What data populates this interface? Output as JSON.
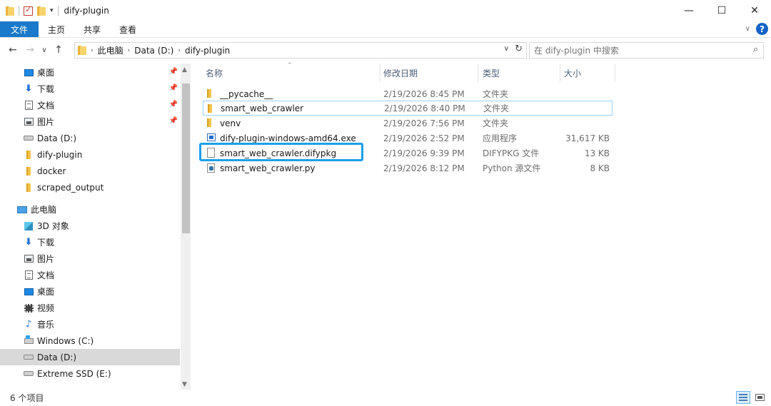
{
  "window": {
    "title": "dify-plugin",
    "minimize": "—",
    "maximize": "☐",
    "close": "✕"
  },
  "ribbon": {
    "tabs": [
      "文件",
      "主页",
      "共享",
      "查看"
    ],
    "help": "?"
  },
  "address": {
    "crumbs": [
      "此电脑",
      "Data (D:)",
      "dify-plugin"
    ]
  },
  "search": {
    "placeholder": "在 dify-plugin 中搜索"
  },
  "nav_pane": {
    "quick_access": [
      {
        "label": "桌面",
        "icon": "desktop-icon",
        "pinned": true
      },
      {
        "label": "下载",
        "icon": "download-icon",
        "pinned": true
      },
      {
        "label": "文档",
        "icon": "document-icon",
        "pinned": true
      },
      {
        "label": "图片",
        "icon": "picture-icon",
        "pinned": true
      },
      {
        "label": "Data (D:)",
        "icon": "drive-icon",
        "pinned": false
      },
      {
        "label": "dify-plugin",
        "icon": "folder-icon",
        "pinned": false
      },
      {
        "label": "docker",
        "icon": "folder-icon",
        "pinned": false
      },
      {
        "label": "scraped_output",
        "icon": "folder-icon",
        "pinned": false
      }
    ],
    "this_pc": {
      "label": "此电脑",
      "items": [
        {
          "label": "3D 对象",
          "icon": "3d-objects-icon"
        },
        {
          "label": "下载",
          "icon": "download-icon"
        },
        {
          "label": "图片",
          "icon": "picture-icon"
        },
        {
          "label": "文档",
          "icon": "document-icon"
        },
        {
          "label": "桌面",
          "icon": "desktop-icon"
        },
        {
          "label": "视频",
          "icon": "video-icon"
        },
        {
          "label": "音乐",
          "icon": "music-icon"
        },
        {
          "label": "Windows (C:)",
          "icon": "windows-drive-icon"
        },
        {
          "label": "Data (D:)",
          "icon": "drive-icon",
          "selected": true
        },
        {
          "label": "Extreme SSD (E:)",
          "icon": "drive-icon"
        }
      ]
    }
  },
  "columns": {
    "name": "名称",
    "date": "修改日期",
    "type": "类型",
    "size": "大小"
  },
  "files": [
    {
      "name": "__pycache__",
      "date": "2/19/2026 8:45 PM",
      "type": "文件夹",
      "size": "",
      "icon": "folder-icon"
    },
    {
      "name": "smart_web_crawler",
      "date": "2/19/2026 8:40 PM",
      "type": "文件夹",
      "size": "",
      "icon": "folder-icon"
    },
    {
      "name": "venv",
      "date": "2/19/2026 7:56 PM",
      "type": "文件夹",
      "size": "",
      "icon": "folder-icon"
    },
    {
      "name": "dify-plugin-windows-amd64.exe",
      "date": "2/19/2026 2:52 PM",
      "type": "应用程序",
      "size": "31,617 KB",
      "icon": "exe-icon"
    },
    {
      "name": "smart_web_crawler.difypkg",
      "date": "2/19/2026 9:39 PM",
      "type": "DIFYPKG 文件",
      "size": "13 KB",
      "icon": "blank-file-icon"
    },
    {
      "name": "smart_web_crawler.py",
      "date": "2/19/2026 8:12 PM",
      "type": "Python 源文件",
      "size": "8 KB",
      "icon": "python-file-icon"
    }
  ],
  "status": {
    "item_count": "6 个项目"
  },
  "colors": {
    "accent": "#1979ca",
    "highlight_box": "#1aa0e8",
    "selection": "#d9d9d9",
    "focus_border": "#99d1ff"
  }
}
